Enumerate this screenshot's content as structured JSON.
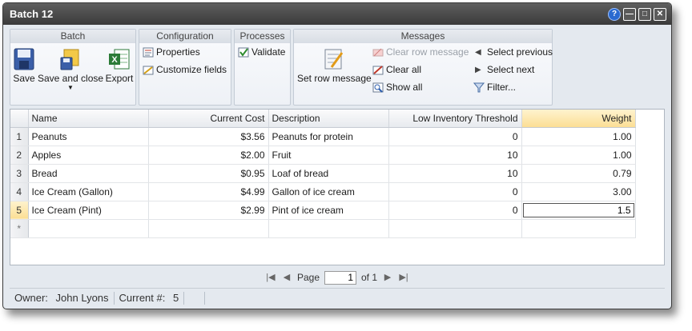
{
  "window": {
    "title": "Batch 12"
  },
  "ribbon": {
    "batch": {
      "title": "Batch",
      "save": "Save",
      "save_close": "Save and close",
      "export": "Export"
    },
    "configuration": {
      "title": "Configuration",
      "properties": "Properties",
      "customize": "Customize fields"
    },
    "processes": {
      "title": "Processes",
      "validate": "Validate"
    },
    "messages": {
      "title": "Messages",
      "set_row": "Set row message",
      "clear_row": "Clear row message",
      "clear_all": "Clear all",
      "show_all": "Show all",
      "select_previous": "Select previous",
      "select_next": "Select next",
      "filter": "Filter..."
    }
  },
  "grid": {
    "columns": [
      "Name",
      "Current Cost",
      "Description",
      "Low Inventory Threshold",
      "Weight"
    ],
    "rows": [
      {
        "num": "1",
        "name": "Peanuts",
        "cost": "$3.56",
        "desc": "Peanuts for protein",
        "threshold": "0",
        "weight": "1.00"
      },
      {
        "num": "2",
        "name": "Apples",
        "cost": "$2.00",
        "desc": "Fruit",
        "threshold": "10",
        "weight": "1.00"
      },
      {
        "num": "3",
        "name": "Bread",
        "cost": "$0.95",
        "desc": "Loaf of bread",
        "threshold": "10",
        "weight": "0.79"
      },
      {
        "num": "4",
        "name": "Ice Cream (Gallon)",
        "cost": "$4.99",
        "desc": "Gallon of ice cream",
        "threshold": "0",
        "weight": "3.00"
      },
      {
        "num": "5",
        "name": "Ice Cream (Pint)",
        "cost": "$2.99",
        "desc": "Pint of ice cream",
        "threshold": "0",
        "weight": "1.5"
      }
    ],
    "new_row_marker": "*"
  },
  "pager": {
    "page_label": "Page",
    "page_value": "1",
    "of_label": "of 1"
  },
  "status": {
    "owner_label": "Owner:",
    "owner": "John Lyons",
    "current_label": "Current #:",
    "current": "5"
  },
  "colors": {
    "titlebar": "#3f3f3f",
    "selected_header": "#fbde94",
    "window_bg": "#e4e9ef"
  }
}
